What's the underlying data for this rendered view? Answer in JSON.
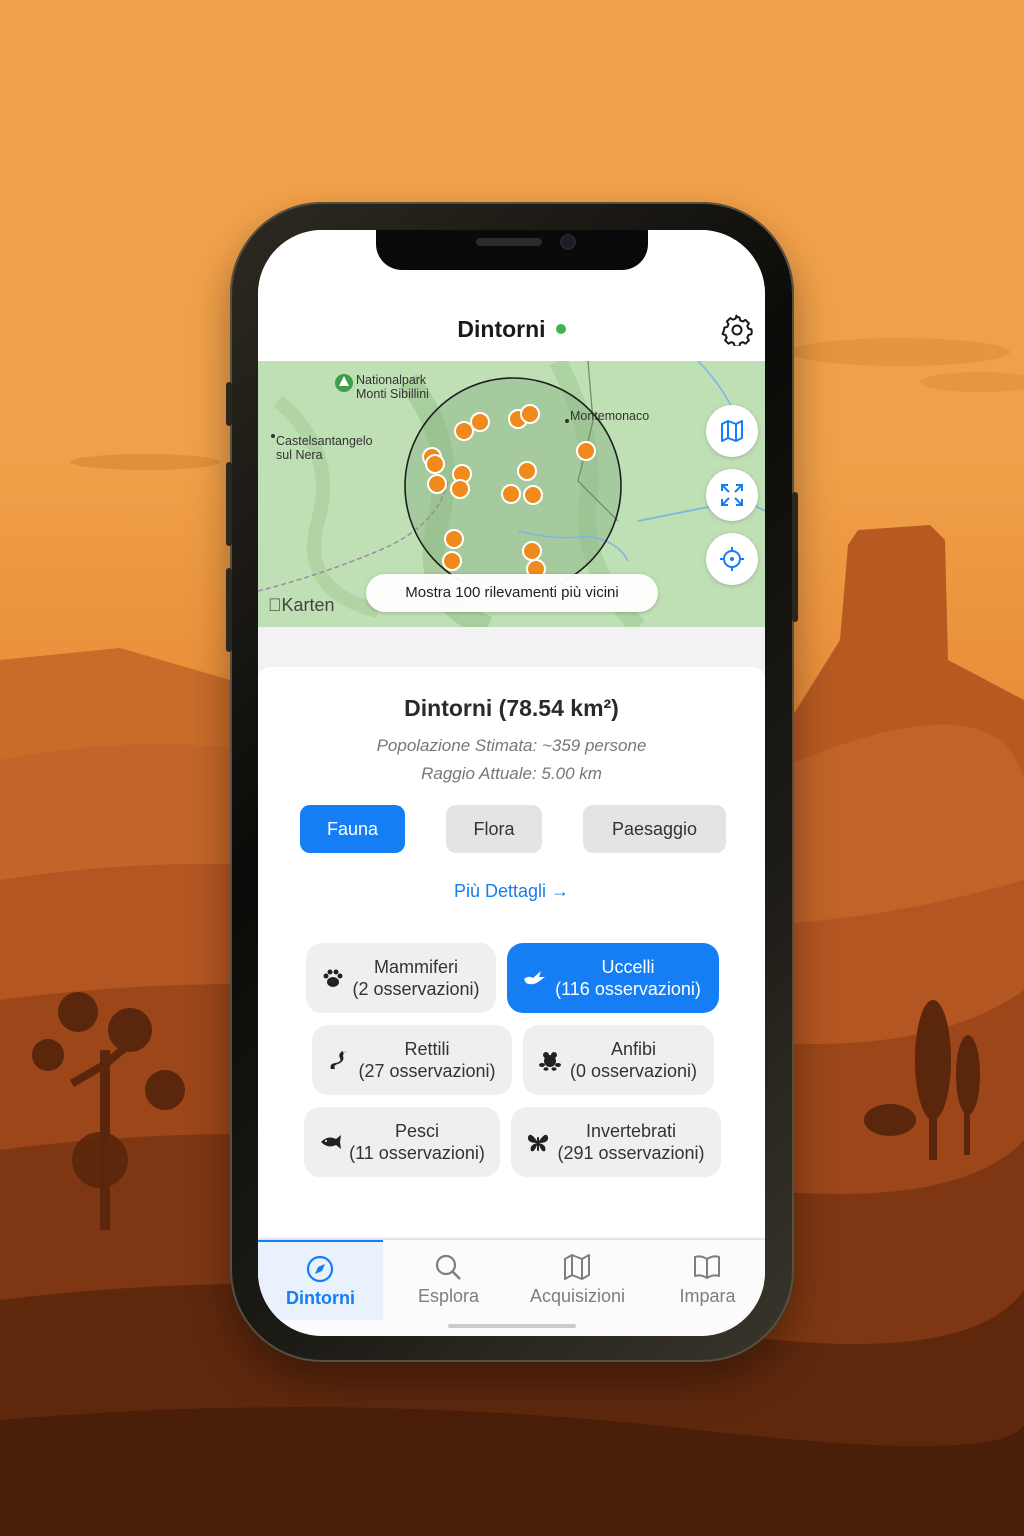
{
  "header": {
    "title": "Dintorni",
    "status_color": "#3cb54a"
  },
  "map": {
    "labels": {
      "park": "Nationalpark\nMonti Sibillini",
      "town_1": "Castelsantangelo\nsul Nera",
      "town_2": "Montemonaco"
    },
    "attribution": "Karten",
    "nearest_button": "Mostra 100 rilevamenti più vicini",
    "marker_color": "#f08a1c"
  },
  "summary": {
    "area_title": "Dintorni (78.54 km²)",
    "population": "Popolazione Stimata: ~359 persone",
    "radius": "Raggio Attuale: 5.00 km"
  },
  "segments": {
    "fauna": "Fauna",
    "flora": "Flora",
    "landscape": "Paesaggio",
    "selected": "Fauna"
  },
  "details_link": "Più Dettagli",
  "categories": {
    "mammals": {
      "name": "Mammiferi",
      "count": "(2 osservazioni)"
    },
    "birds": {
      "name": "Uccelli",
      "count": "(116 osservazioni)"
    },
    "reptiles": {
      "name": "Rettili",
      "count": "(27 osservazioni)"
    },
    "amphibians": {
      "name": "Anfibi",
      "count": "(0 osservazioni)"
    },
    "fish": {
      "name": "Pesci",
      "count": "(11 osservazioni)"
    },
    "invertebrates": {
      "name": "Invertebrati",
      "count": "(291 osservazioni)"
    }
  },
  "tabs": {
    "nearby": "Dintorni",
    "explore": "Esplora",
    "acquisitions": "Acquisizioni",
    "learn": "Impara",
    "selected": "Dintorni"
  },
  "colors": {
    "accent": "#157ef5",
    "background_sky": "#f2a14a"
  }
}
